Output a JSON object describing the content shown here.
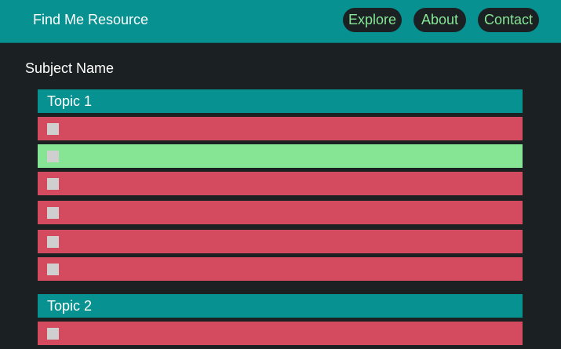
{
  "app": {
    "brand": "Find Me Resource"
  },
  "nav": {
    "items": [
      {
        "label": "Explore"
      },
      {
        "label": "About"
      },
      {
        "label": "Contact"
      }
    ]
  },
  "colors": {
    "header": "#079191",
    "background": "#1b2023",
    "pending": "#d44a5f",
    "done": "#86e595",
    "nav_text": "#86e595"
  },
  "subject": {
    "name": "Subject Name"
  },
  "topics": [
    {
      "title": "Topic 1",
      "items": [
        {
          "checked": false,
          "status": "pending"
        },
        {
          "checked": false,
          "status": "done"
        },
        {
          "checked": false,
          "status": "pending"
        },
        {
          "checked": false,
          "status": "pending"
        },
        {
          "checked": false,
          "status": "pending"
        },
        {
          "checked": false,
          "status": "pending"
        }
      ]
    },
    {
      "title": "Topic 2",
      "items": [
        {
          "checked": false,
          "status": "pending"
        }
      ]
    }
  ]
}
